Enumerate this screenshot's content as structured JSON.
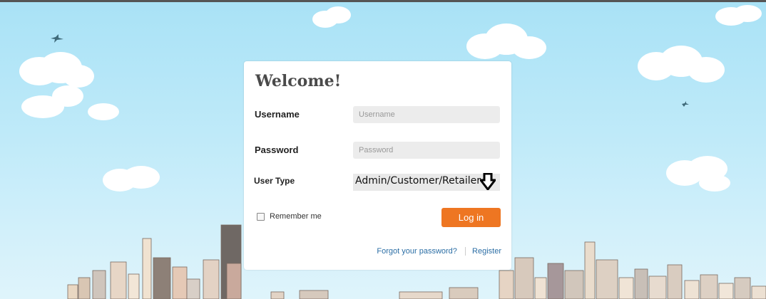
{
  "login": {
    "title": "Welcome!",
    "username": {
      "label": "Username",
      "placeholder": "Username"
    },
    "password": {
      "label": "Password",
      "placeholder": "Password"
    },
    "user_type": {
      "label": "User Type",
      "value": "Admin/Customer/Retailer"
    },
    "remember_label": "Remember me",
    "login_button": "Log in",
    "forgot_link": "Forgot your password?",
    "register_link": "Register"
  },
  "colors": {
    "accent": "#ee7622",
    "link": "#2b6ea5",
    "sky": "#bfeaf9"
  },
  "icons": {
    "select_indicator": "down-arrow-icon"
  }
}
